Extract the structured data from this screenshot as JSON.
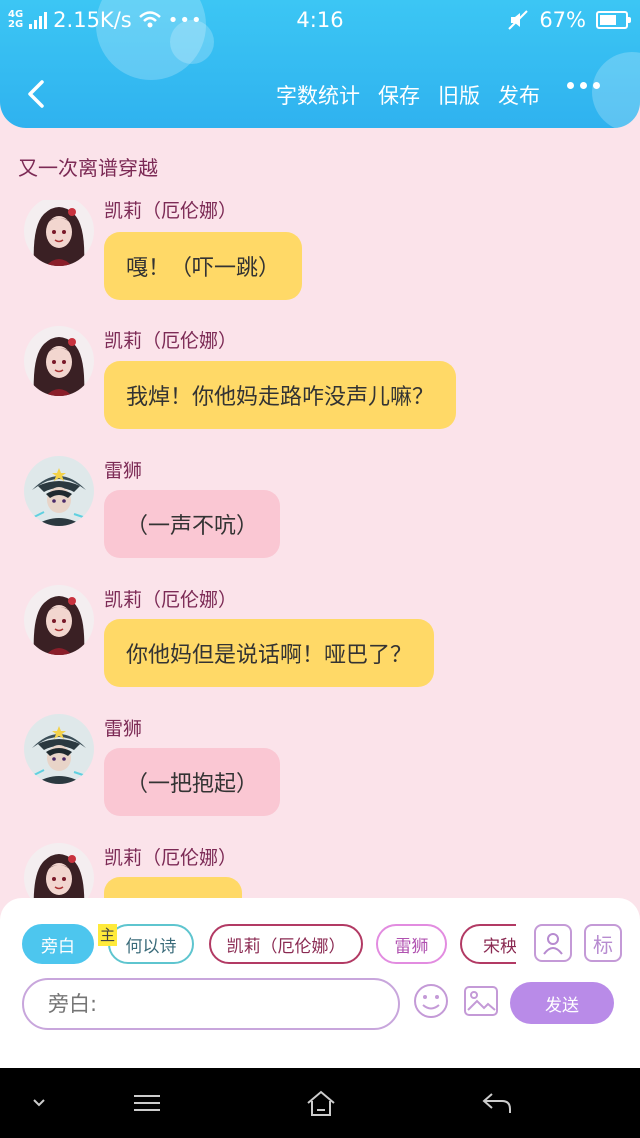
{
  "status_bar": {
    "network_top": "4G",
    "network_bottom": "2G",
    "speed": "2.15K/s",
    "time": "4:16",
    "battery": "67%",
    "battery_level": 0.67
  },
  "nav": {
    "actions": [
      "字数统计",
      "保存",
      "旧版",
      "发布"
    ]
  },
  "story_title": "又一次离谱穿越",
  "messages": [
    {
      "sender": "凯莉（厄伦娜）",
      "text": "嘎！（吓一跳）",
      "style": "yellow",
      "avatar": "kelly"
    },
    {
      "sender": "凯莉（厄伦娜）",
      "text": "我焯！你他妈走路咋没声儿嘛？",
      "style": "yellow",
      "avatar": "kelly"
    },
    {
      "sender": "雷狮",
      "text": "（一声不吭）",
      "style": "pink",
      "avatar": "leishi"
    },
    {
      "sender": "凯莉（厄伦娜）",
      "text": "你他妈但是说话啊！哑巴了？",
      "style": "yellow",
      "avatar": "kelly"
    },
    {
      "sender": "雷狮",
      "text": "（一把抱起）",
      "style": "pink",
      "avatar": "leishi"
    },
    {
      "sender": "凯莉（厄伦娜）",
      "text": "",
      "style": "yellow",
      "avatar": "kelly"
    }
  ],
  "characters": {
    "narration": "旁白",
    "main_tag": "主",
    "c1": "何以诗",
    "c2": "凯莉（厄伦娜）",
    "c3": "雷狮",
    "c4": "宋秧"
  },
  "tools": {
    "label_icon_text": "标"
  },
  "input": {
    "placeholder": "旁白:"
  },
  "send_label": "发送",
  "colors": {
    "header": "#3cc6f4",
    "yellow_bubble": "#ffd967",
    "pink_bubble": "#fac7d3",
    "send": "#b98be8",
    "background": "#fbe3ea"
  }
}
